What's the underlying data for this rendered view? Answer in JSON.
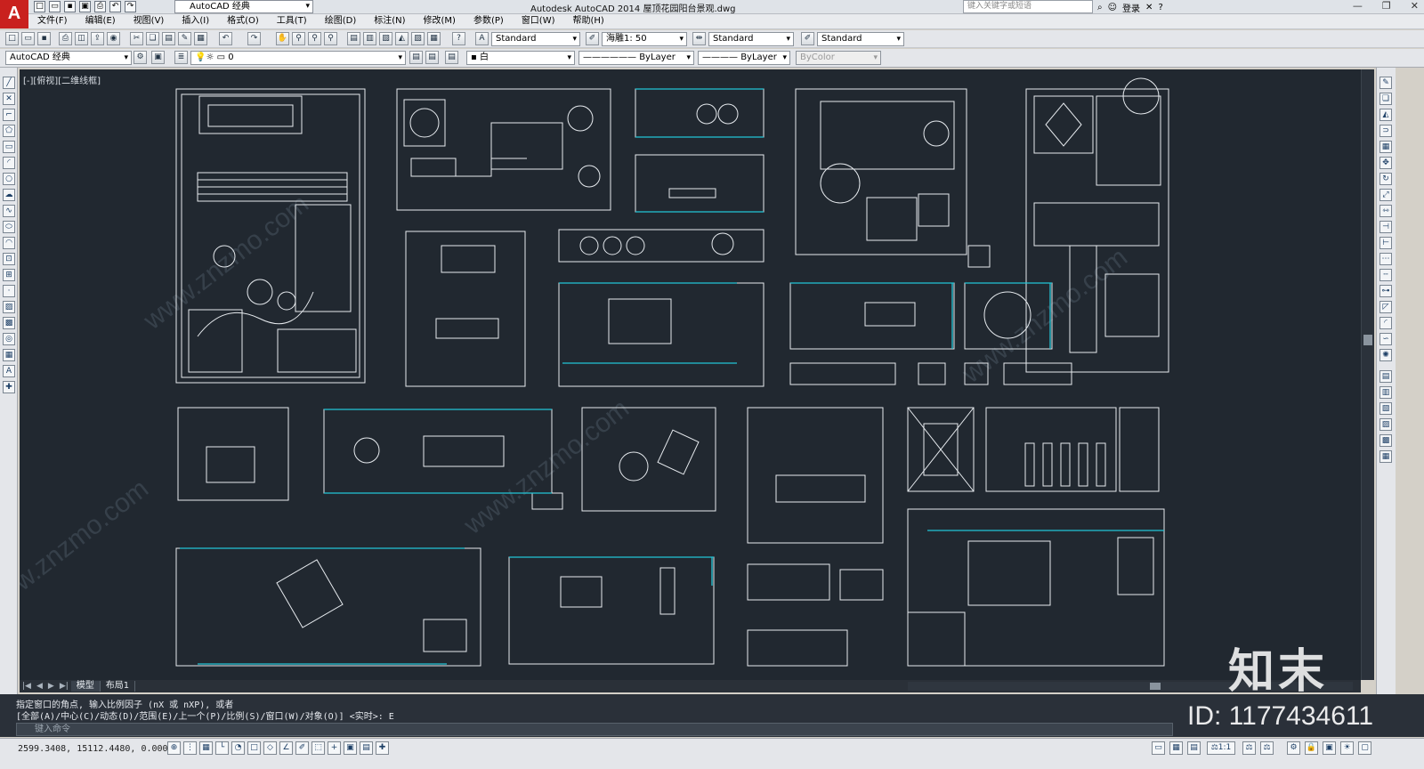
{
  "app": {
    "logo": "A",
    "title": "Autodesk AutoCAD 2014    屋顶花园阳台景观.dwg",
    "workspace": "AutoCAD 经典",
    "search_placeholder": "键入关键字或短语",
    "login": "登录"
  },
  "menu": [
    "文件(F)",
    "编辑(E)",
    "视图(V)",
    "插入(I)",
    "格式(O)",
    "工具(T)",
    "绘图(D)",
    "标注(N)",
    "修改(M)",
    "参数(P)",
    "窗口(W)",
    "帮助(H)"
  ],
  "toolbar": {
    "text_style": "Standard",
    "annotation_scale": "海雕1: 50",
    "dim_style": "Standard",
    "table_style": "Standard",
    "workspace_combo": "AutoCAD 经典",
    "layer": "0",
    "color": "白",
    "linetype": "ByLayer",
    "lineweight": "ByLayer",
    "plotstyle": "ByColor"
  },
  "canvas": {
    "view_label": "[-][俯视][二维线框]",
    "background": "#212830",
    "line_color": "#e8ecf0",
    "accent_color": "#22c5d6"
  },
  "tabs": [
    "模型",
    "布局1"
  ],
  "command": {
    "line1": "指定窗口的角点, 输入比例因子 (nX 或 nXP), 或者",
    "line2": "[全部(A)/中心(C)/动态(D)/范围(E)/上一个(P)/比例(S)/窗口(W)/对象(O)] <实时>: E",
    "input_placeholder": "键入命令"
  },
  "status": {
    "coordinates": "2599.3408,   15112.4480, 0.0000",
    "scale": "1:1"
  },
  "watermark": {
    "logo": "知末",
    "id": "ID: 1177434611",
    "site": "www.znzmo.com"
  }
}
